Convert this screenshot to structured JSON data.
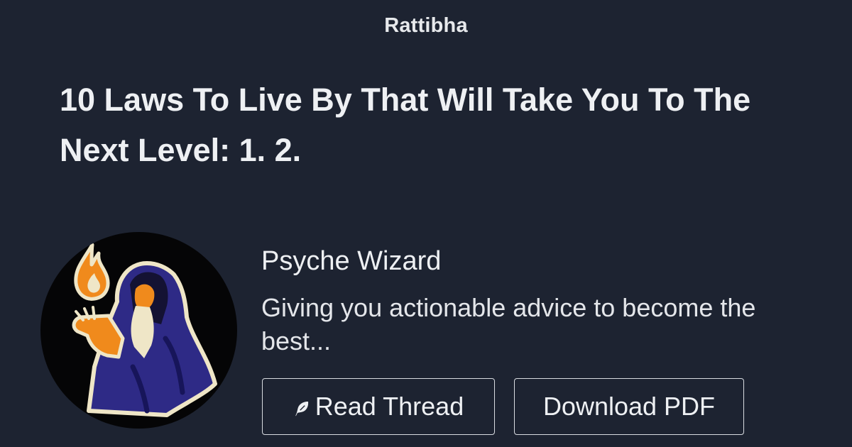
{
  "site": {
    "name": "Rattibha"
  },
  "thread": {
    "title": "10 Laws To Live By That Will Take You To The Next Level: 1. 2."
  },
  "author": {
    "avatar_icon": "wizard-avatar-icon",
    "name": "Psyche Wizard",
    "bio": "Giving you actionable advice to become the best..."
  },
  "actions": {
    "read_thread": {
      "label": "Read Thread",
      "icon": "feather-icon"
    },
    "download_pdf": {
      "label": "Download PDF"
    }
  },
  "colors": {
    "background": "#1d2331",
    "text": "#eef0f3",
    "button_border": "#d9dce1",
    "avatar_robe": "#2e2a86",
    "avatar_accent": "#f08a1c",
    "avatar_outline": "#efe6c7"
  }
}
